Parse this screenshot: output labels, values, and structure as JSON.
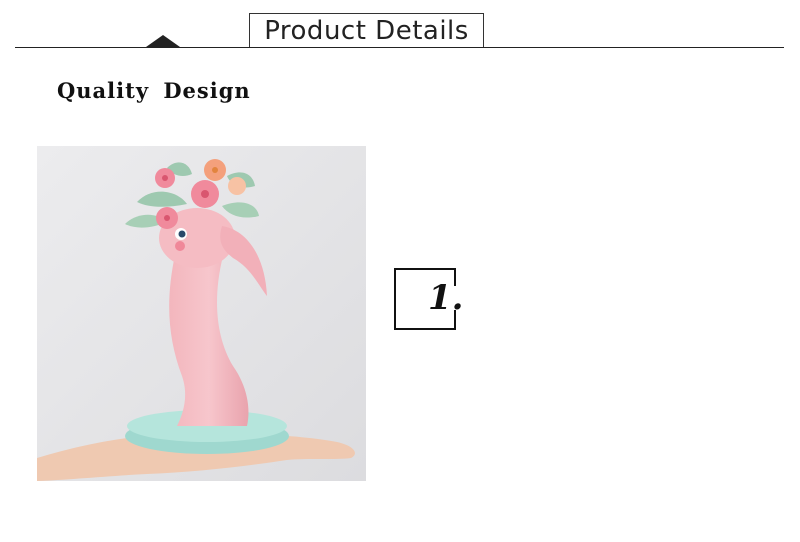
{
  "header": {
    "title": "Product Details"
  },
  "section": {
    "subtitle": "Quality  Design"
  },
  "product_image": {
    "description_icon": "flamingo-figurine"
  },
  "step": {
    "number": "1."
  }
}
